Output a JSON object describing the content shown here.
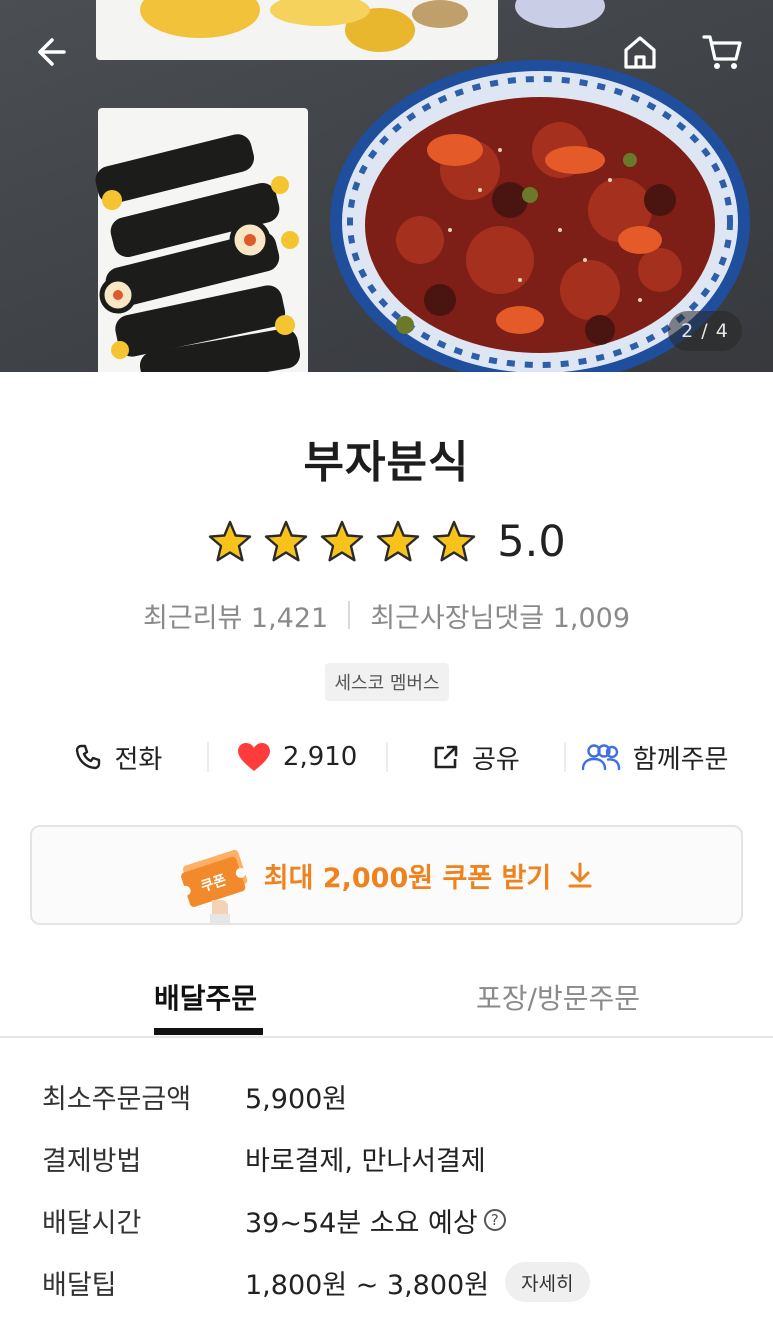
{
  "hero": {
    "image_counter": "2 / 4"
  },
  "store": {
    "name": "부자분식",
    "rating": "5.0",
    "stars": 5
  },
  "reviews": {
    "recent_reviews": "최근리뷰 1,421",
    "owner_replies": "최근사장님댓글 1,009"
  },
  "badge": "세스코 멤버스",
  "actions": {
    "call": "전화",
    "likes": "2,910",
    "share": "공유",
    "group_order": "함께주문"
  },
  "coupon": {
    "label": "최대 2,000원 쿠폰 받기",
    "icon_text": "쿠폰"
  },
  "tabs": {
    "delivery": "배달주문",
    "pickup": "포장/방문주문"
  },
  "details": {
    "min_order": {
      "label": "최소주문금액",
      "value": "5,900원"
    },
    "payment": {
      "label": "결제방법",
      "value": "바로결제, 만나서결제"
    },
    "delivery_time": {
      "label": "배달시간",
      "value": "39~54분 소요 예상"
    },
    "delivery_tip": {
      "label": "배달팁",
      "value": "1,800원 ~ 3,800원",
      "more_label": "자세히"
    }
  },
  "colors": {
    "accent": "#f0821e",
    "heart": "#ff3b3b",
    "group_icon": "#3f6fe0",
    "star": "#f7c21b"
  },
  "icons": [
    "back-arrow-icon",
    "home-icon",
    "cart-icon",
    "star-icon",
    "phone-icon",
    "heart-icon",
    "share-icon",
    "group-icon",
    "coupon-icon",
    "download-arrow-icon",
    "help-icon"
  ]
}
